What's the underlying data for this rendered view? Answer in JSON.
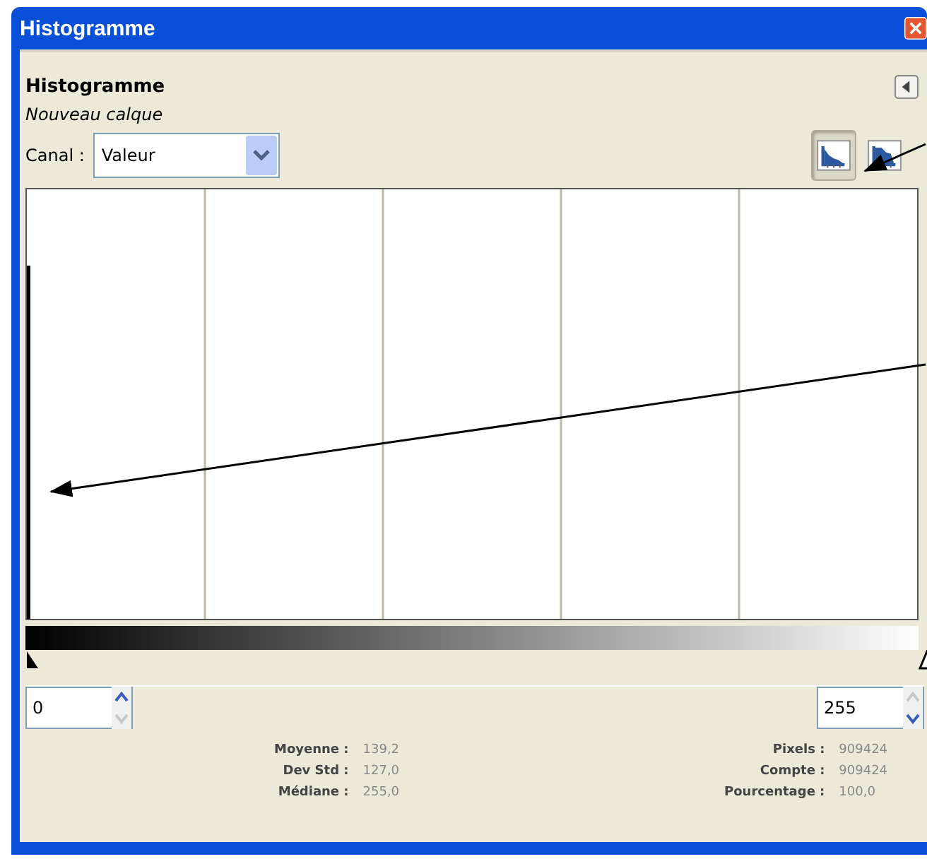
{
  "window": {
    "title": "Histogramme"
  },
  "dock": {
    "title": "Histogramme",
    "subtitle": "Nouveau calque"
  },
  "channel": {
    "label": "Canal :",
    "value": "Valeur"
  },
  "scale_buttons": [
    {
      "kind": "linear",
      "selected": true
    },
    {
      "kind": "logarithmic",
      "selected": false
    }
  ],
  "range": {
    "start": "0",
    "end": "255"
  },
  "stats_left": [
    {
      "label": "Moyenne :",
      "value": "139,2"
    },
    {
      "label": "Dev Std :",
      "value": "127,0"
    },
    {
      "label": "Médiane :",
      "value": "255,0"
    }
  ],
  "stats_right": [
    {
      "label": "Pixels :",
      "value": "909424"
    },
    {
      "label": "Compte :",
      "value": "909424"
    },
    {
      "label": "Pourcentage :",
      "value": "100,0"
    }
  ]
}
